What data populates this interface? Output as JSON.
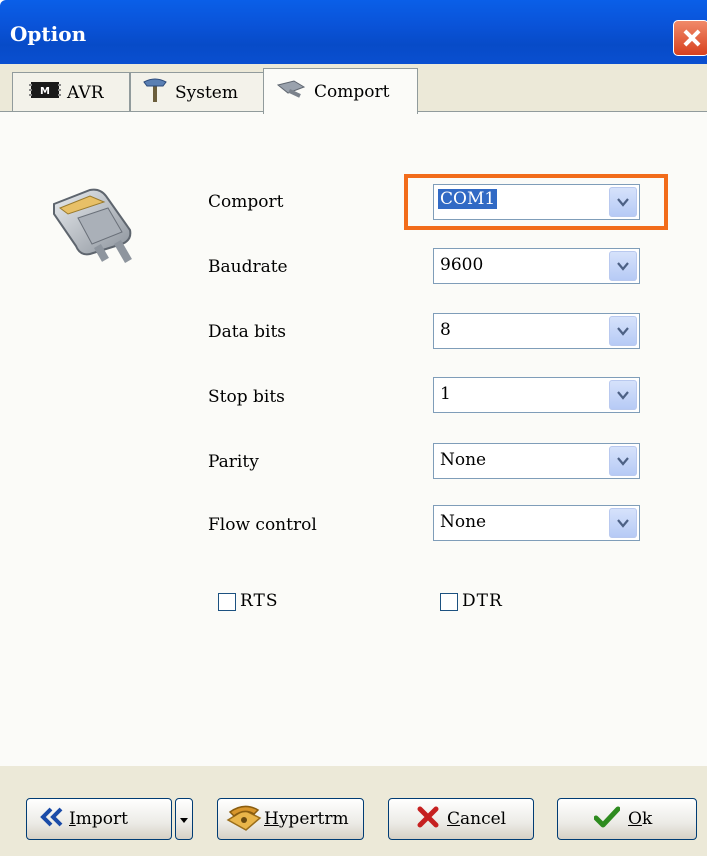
{
  "window": {
    "title": "Option"
  },
  "tabs": [
    {
      "label": "AVR",
      "icon": "avr-chip-icon"
    },
    {
      "label": "System",
      "icon": "tools-icon"
    },
    {
      "label": "Comport",
      "icon": "magnifier-icon",
      "active": true
    }
  ],
  "form": {
    "comport": {
      "label": "Comport",
      "value": "COM1"
    },
    "baudrate": {
      "label": "Baudrate",
      "value": "9600"
    },
    "databits": {
      "label": "Data bits",
      "value": "8"
    },
    "stopbits": {
      "label": "Stop bits",
      "value": "1"
    },
    "parity": {
      "label": "Parity",
      "value": "None"
    },
    "flowcontrol": {
      "label": "Flow control",
      "value": "None"
    }
  },
  "checkboxes": {
    "rts": {
      "label": "RTS",
      "checked": false
    },
    "dtr": {
      "label": "DTR",
      "checked": false
    }
  },
  "buttons": {
    "import_first": "I",
    "import_rest": "mport",
    "hypertrm_first": "H",
    "hypertrm_rest": "ypertrm",
    "cancel_first": "C",
    "cancel_rest": "ancel",
    "ok_first": "O",
    "ok_rest": "k"
  },
  "colors": {
    "highlight": "#f26c1b",
    "titlebar": "#0a53d8",
    "selection": "#316ac5"
  }
}
